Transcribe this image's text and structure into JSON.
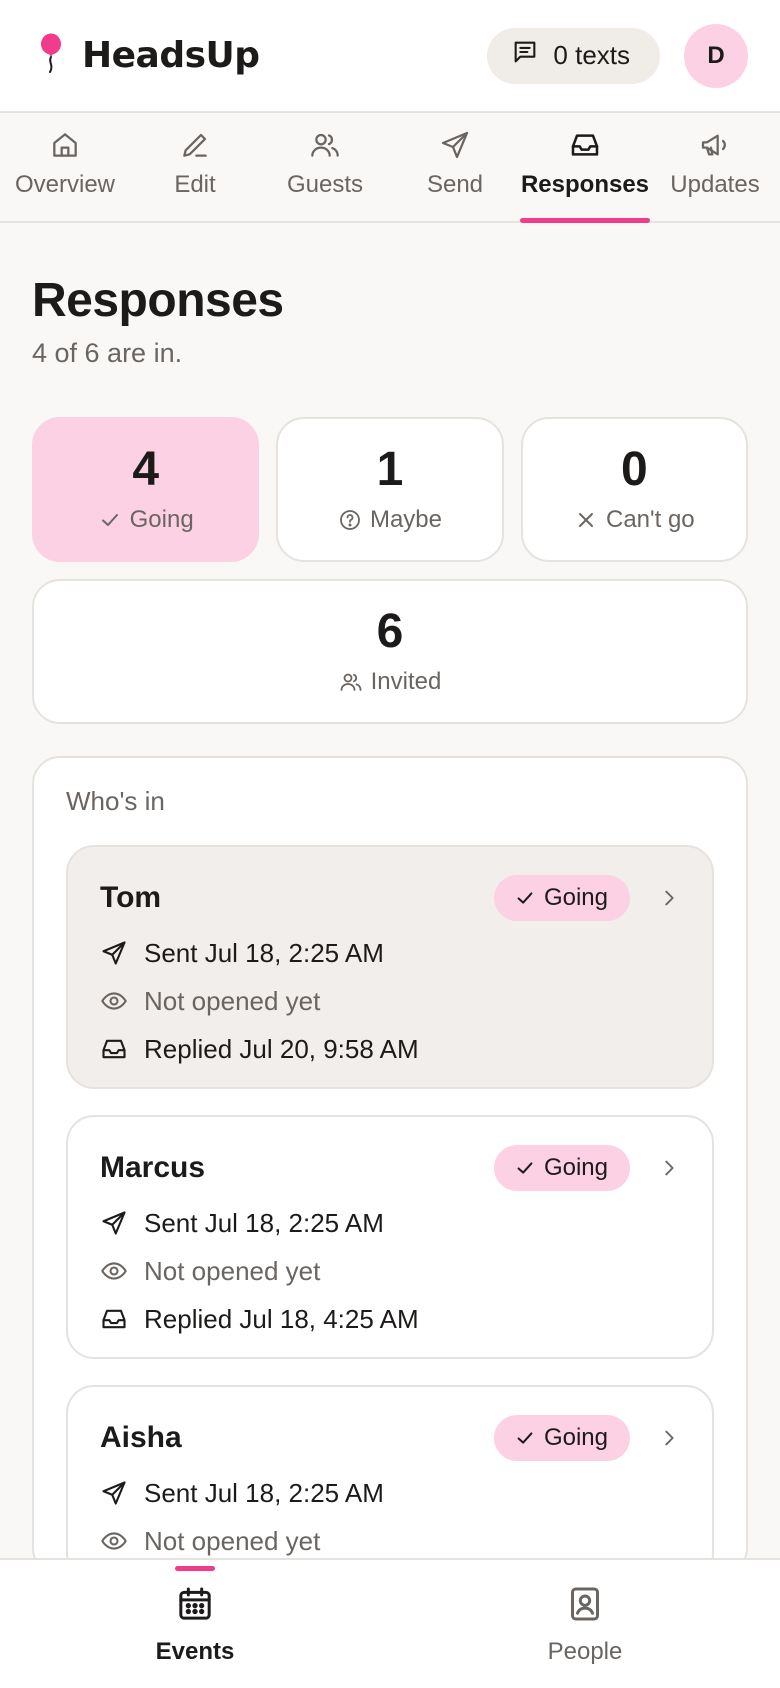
{
  "brand": {
    "name": "HeadsUp",
    "accent": "#f03c8b"
  },
  "header": {
    "texts_label": "0 texts",
    "avatar_initial": "D"
  },
  "tabs": [
    {
      "label": "Overview",
      "icon": "home-icon"
    },
    {
      "label": "Edit",
      "icon": "pencil-icon"
    },
    {
      "label": "Guests",
      "icon": "users-icon"
    },
    {
      "label": "Send",
      "icon": "send-icon"
    },
    {
      "label": "Responses",
      "icon": "inbox-icon",
      "active": true
    },
    {
      "label": "Updates",
      "icon": "megaphone-icon"
    }
  ],
  "page": {
    "title": "Responses",
    "subtitle": "4 of 6 are in."
  },
  "stats": {
    "going": {
      "count": "4",
      "label": "Going"
    },
    "maybe": {
      "count": "1",
      "label": "Maybe"
    },
    "cant_go": {
      "count": "0",
      "label": "Can't go"
    },
    "invited": {
      "count": "6",
      "label": "Invited"
    }
  },
  "whos_in": {
    "title": "Who's in",
    "people": [
      {
        "name": "Tom",
        "status": "Going",
        "sent": "Sent Jul 18, 2:25 AM",
        "opened": "Not opened yet",
        "replied": "Replied Jul 20, 9:58 AM"
      },
      {
        "name": "Marcus",
        "status": "Going",
        "sent": "Sent Jul 18, 2:25 AM",
        "opened": "Not opened yet",
        "replied": "Replied Jul 18, 4:25 AM"
      },
      {
        "name": "Aisha",
        "status": "Going",
        "sent": "Sent Jul 18, 2:25 AM",
        "opened": "Not opened yet"
      }
    ]
  },
  "bottom_nav": [
    {
      "label": "Events",
      "icon": "calendar-icon",
      "active": true
    },
    {
      "label": "People",
      "icon": "contact-book-icon"
    }
  ]
}
